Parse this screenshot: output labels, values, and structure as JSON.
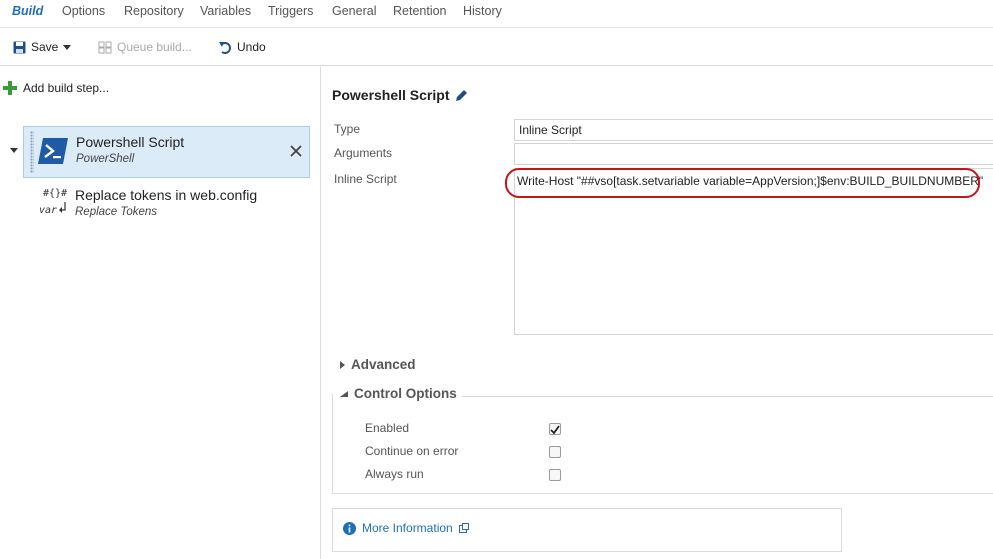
{
  "tabs": [
    {
      "label": "Build"
    },
    {
      "label": "Options"
    },
    {
      "label": "Repository"
    },
    {
      "label": "Variables"
    },
    {
      "label": "Triggers"
    },
    {
      "label": "General"
    },
    {
      "label": "Retention"
    },
    {
      "label": "History"
    }
  ],
  "toolbar": {
    "save_label": "Save",
    "queue_label": "Queue build...",
    "undo_label": "Undo"
  },
  "left": {
    "add_step_label": "Add build step...",
    "tasks": [
      {
        "title": "Powershell Script",
        "subtitle": "PowerShell",
        "icon_text": "#{}#",
        "selected": true
      },
      {
        "title": "Replace tokens in web.config",
        "subtitle": "Replace Tokens",
        "icon_text": "#{}#",
        "icon_text2": "var"
      }
    ]
  },
  "detail": {
    "heading": "Powershell Script",
    "type_label": "Type",
    "type_value": "Inline Script",
    "arguments_label": "Arguments",
    "arguments_value": "",
    "inline_label": "Inline Script",
    "inline_value": "Write-Host \"##vso[task.setvariable variable=AppVersion;]$env:BUILD_BUILDNUMBER\"",
    "advanced_label": "Advanced",
    "control_label": "Control Options",
    "options": [
      {
        "label": "Enabled",
        "checked": true
      },
      {
        "label": "Continue on error",
        "checked": false
      },
      {
        "label": "Always run",
        "checked": false
      }
    ],
    "more_info_label": "More Information"
  },
  "colors": {
    "accent": "#1e6fb8",
    "highlight_ring": "#c3151b",
    "selected_bg": "#dcebf8",
    "add_green": "#3a9a3a"
  }
}
